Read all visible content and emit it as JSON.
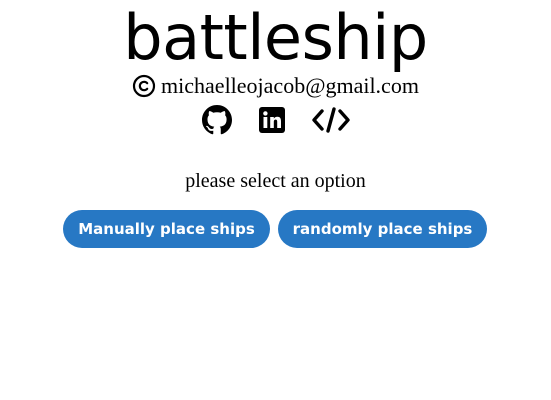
{
  "header": {
    "title": "battleship",
    "email": "michaelleojacob@gmail.com"
  },
  "links": [
    {
      "icon": "github-icon"
    },
    {
      "icon": "linkedin-icon"
    },
    {
      "icon": "code-icon"
    }
  ],
  "main": {
    "prompt": "please select an option",
    "buttons": {
      "manual_label": "Manually place ships",
      "random_label": "randomly place ships"
    }
  },
  "colors": {
    "button_bg": "#2778c4",
    "button_text": "#ffffff",
    "text": "#000000"
  }
}
